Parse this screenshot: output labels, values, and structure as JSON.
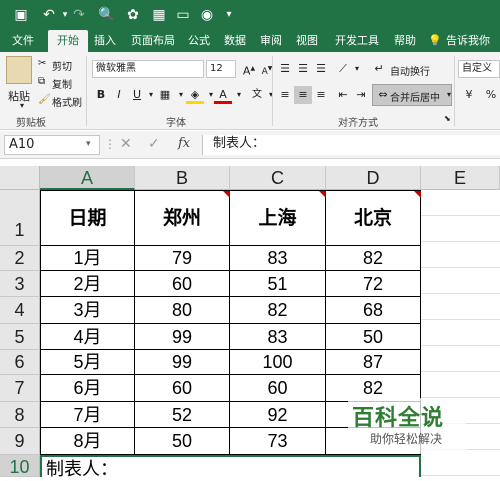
{
  "ribbon": {
    "tabs": [
      "文件",
      "开始",
      "插入",
      "页面布局",
      "公式",
      "数据",
      "审阅",
      "视图",
      "开发工具",
      "帮助"
    ],
    "tell_me": "告诉我你想",
    "paste": "粘贴",
    "cut": "剪切",
    "copy": "复制",
    "format_painter": "格式刷",
    "clipboard_group": "剪贴板",
    "font_name": "微软雅黑",
    "font_size": "12",
    "font_group": "字体",
    "wrap_text": "自动换行",
    "merge_center": "合并后居中",
    "alignment_group": "对齐方式",
    "number_format": "自定义",
    "percent": "%"
  },
  "formula_bar": {
    "name_box": "A10",
    "fx": "fx",
    "content": "制表人："
  },
  "columns": [
    "A",
    "B",
    "C",
    "D",
    "E"
  ],
  "rows": [
    "1",
    "2",
    "3",
    "4",
    "5",
    "6",
    "7",
    "8",
    "9",
    "10"
  ],
  "table": {
    "headers": [
      "日期",
      "郑州",
      "上海",
      "北京"
    ],
    "data": [
      [
        "1月",
        "79",
        "83",
        "82"
      ],
      [
        "2月",
        "60",
        "51",
        "72"
      ],
      [
        "3月",
        "80",
        "82",
        "68"
      ],
      [
        "4月",
        "99",
        "83",
        "50"
      ],
      [
        "5月",
        "99",
        "100",
        "87"
      ],
      [
        "6月",
        "60",
        "60",
        "82"
      ],
      [
        "7月",
        "52",
        "92",
        ""
      ],
      [
        "8月",
        "50",
        "73",
        ""
      ]
    ],
    "footer": "制表人："
  },
  "watermark": {
    "title": "百科全说",
    "subtitle": "助你轻松解决"
  }
}
